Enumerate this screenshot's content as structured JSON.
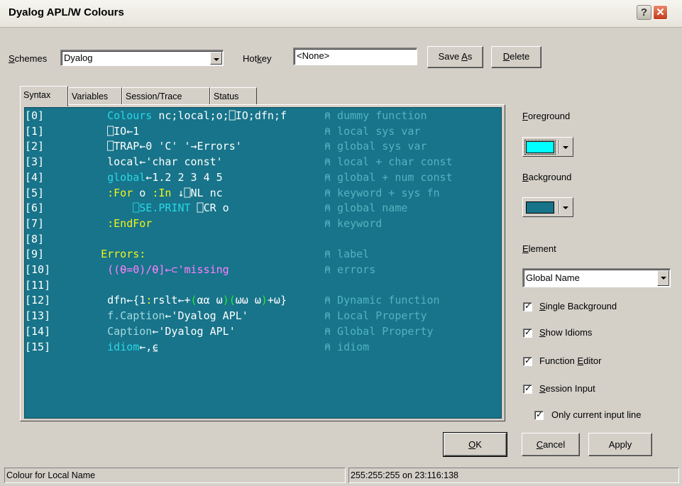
{
  "window": {
    "title": "Dyalog APL/W Colours",
    "help_glyph": "?",
    "close_glyph": "✕"
  },
  "top": {
    "schemes_label_prefix": "",
    "schemes_label_u": "S",
    "schemes_label_rest": "chemes",
    "schemes_value": "Dyalog",
    "hotkey_label_prefix": "Hot",
    "hotkey_label_u": "k",
    "hotkey_label_rest": "ey",
    "hotkey_value": "<None>",
    "save_as_prefix": "Save ",
    "save_as_u": "A",
    "save_as_rest": "s",
    "delete_u": "D",
    "delete_rest": "elete"
  },
  "tabs": [
    "Syntax",
    "Variables",
    "Session/Trace",
    "Status"
  ],
  "editor": {
    "lines": [
      {
        "ln": "[0]",
        "comment": "⍝ dummy function",
        "segments": [
          [
            "    ",
            "c-white"
          ],
          [
            "Colours",
            "c-cyan"
          ],
          [
            " nc;local;o;⎕IO;dfn;f",
            "c-white"
          ]
        ]
      },
      {
        "ln": "[1]",
        "comment": "⍝ local sys var",
        "segments": [
          [
            "    ⎕IO←1",
            "c-white"
          ]
        ]
      },
      {
        "ln": "[2]",
        "comment": "⍝ global sys var",
        "segments": [
          [
            "    ⎕TRAP←0 'C' '→Errors'",
            "c-white"
          ]
        ]
      },
      {
        "ln": "[3]",
        "comment": "⍝ local + char const",
        "segments": [
          [
            "    local←'char const'",
            "c-white"
          ]
        ]
      },
      {
        "ln": "[4]",
        "comment": "⍝ global + num const",
        "segments": [
          [
            "    ",
            "c-white"
          ],
          [
            "global",
            "c-cyan"
          ],
          [
            "←1.2 2 3 4 5",
            "c-white"
          ]
        ]
      },
      {
        "ln": "[5]",
        "comment": "⍝ keyword + sys fn",
        "segments": [
          [
            "    ",
            "c-white"
          ],
          [
            ":For",
            "c-yellow"
          ],
          [
            " o ",
            "c-white"
          ],
          [
            ":In",
            "c-yellow"
          ],
          [
            " ↓⎕NL nc",
            "c-white"
          ]
        ]
      },
      {
        "ln": "[6]",
        "comment": "⍝ global name",
        "segments": [
          [
            "        ",
            "c-white"
          ],
          [
            "⎕SE.PRINT",
            "c-cyan"
          ],
          [
            " ⎕CR o",
            "c-white"
          ]
        ]
      },
      {
        "ln": "[7]",
        "comment": "⍝ keyword",
        "segments": [
          [
            "    ",
            "c-white"
          ],
          [
            ":EndFor",
            "c-yellow"
          ]
        ]
      },
      {
        "ln": "[8]",
        "comment": "",
        "segments": []
      },
      {
        "ln": "[9]",
        "comment": "⍝ label",
        "segments": [
          [
            "   ",
            "c-white"
          ],
          [
            "Errors:",
            "c-yellow"
          ]
        ]
      },
      {
        "ln": "[10]",
        "comment": "⍝ errors",
        "segments": [
          [
            "    ",
            "c-white"
          ],
          [
            "((⍬=0)/⍬]←⊂'missing",
            "c-pink"
          ]
        ]
      },
      {
        "ln": "[11]",
        "comment": "",
        "segments": []
      },
      {
        "ln": "[12]",
        "comment": "⍝ Dynamic function",
        "segments": [
          [
            "    dfn←{1",
            "c-white"
          ],
          [
            ":",
            "c-yellow"
          ],
          [
            "rslt←+",
            "c-white"
          ],
          [
            "(",
            "c-green"
          ],
          [
            "αα ω",
            "c-white"
          ],
          [
            ")(",
            "c-green"
          ],
          [
            "ωω ω",
            "c-white"
          ],
          [
            ")",
            "c-green"
          ],
          [
            "+ω}",
            "c-white"
          ]
        ]
      },
      {
        "ln": "[13]",
        "comment": "⍝ Local Property",
        "segments": [
          [
            "    ",
            "c-white"
          ],
          [
            "f.Caption",
            "c-dim"
          ],
          [
            "←'Dyalog APL'",
            "c-white"
          ]
        ]
      },
      {
        "ln": "[14]",
        "comment": "⍝ Global Property",
        "segments": [
          [
            "    ",
            "c-white"
          ],
          [
            "Caption",
            "c-dim"
          ],
          [
            "←'Dyalog APL'",
            "c-white"
          ]
        ]
      },
      {
        "ln": "[15]",
        "comment": "⍝ idiom",
        "segments": [
          [
            "    ",
            "c-white"
          ],
          [
            "idiom",
            "c-cyan"
          ],
          [
            "←,⍷",
            "c-white"
          ]
        ]
      }
    ]
  },
  "right": {
    "foreground_u": "F",
    "foreground_rest": "oreground",
    "background_u": "B",
    "background_rest": "ackground",
    "element_u": "E",
    "element_rest": "lement",
    "element_value": "Global Name",
    "foreground_color": "#00ffff",
    "background_color": "#17748a",
    "checks": [
      {
        "u": "S",
        "rest": "ingle Background",
        "pre": ""
      },
      {
        "u": "S",
        "rest": "how Idioms",
        "pre": ""
      },
      {
        "pre": "Function ",
        "u": "E",
        "rest": "ditor"
      },
      {
        "u": "S",
        "rest": "ession Input",
        "pre": ""
      },
      {
        "pre": "Only current input line",
        "u": "",
        "rest": ""
      }
    ]
  },
  "buttons": {
    "ok_u": "O",
    "ok_rest": "K",
    "cancel_u": "C",
    "cancel_rest": "ancel",
    "apply": "Apply"
  },
  "status": {
    "left": "Colour for Local Name",
    "right": "255:255:255 on 23:116:138"
  }
}
